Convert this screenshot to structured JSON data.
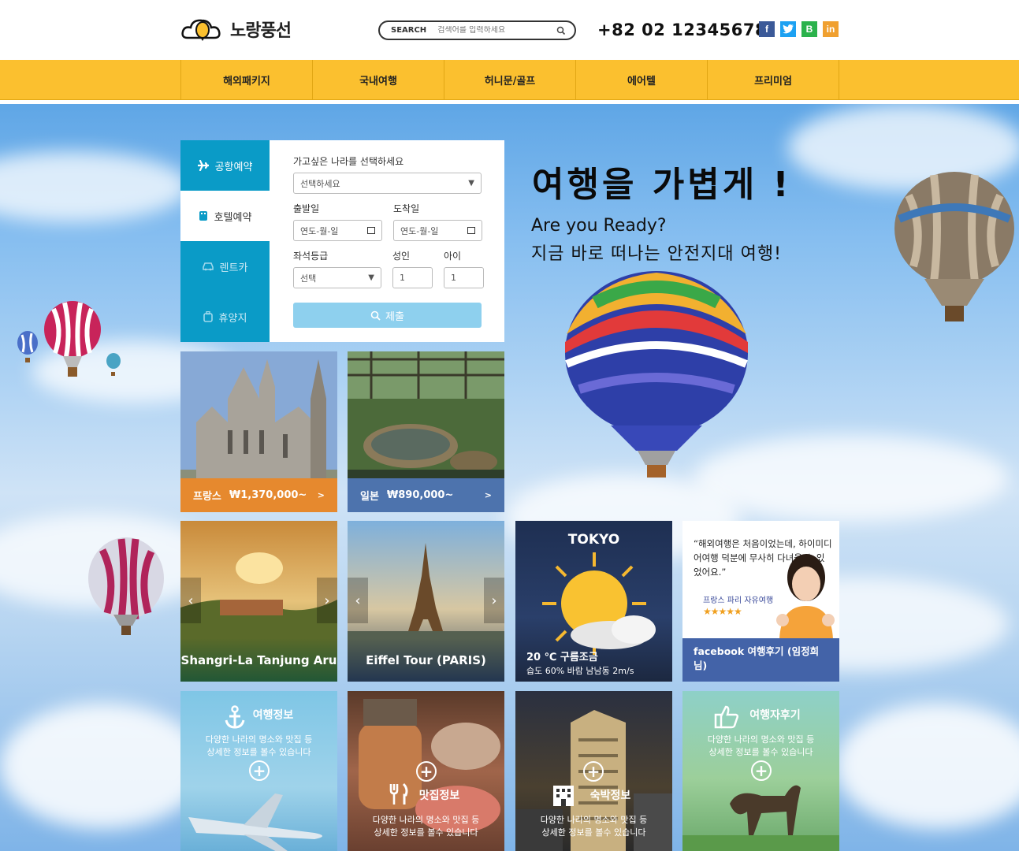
{
  "header": {
    "logo_text": "노랑풍선",
    "search_label": "SEARCH",
    "search_placeholder": "검색어를 입력하세요",
    "phone": "+82 02 12345678",
    "social": [
      {
        "name": "facebook-icon",
        "glyph": "f",
        "color": "#3b5998"
      },
      {
        "name": "twitter-icon",
        "glyph": "t",
        "color": "#1da1f2"
      },
      {
        "name": "blog-icon",
        "glyph": "B",
        "color": "#2bb24c"
      },
      {
        "name": "linkedin-icon",
        "glyph": "in",
        "color": "#f0a030"
      }
    ]
  },
  "nav": {
    "items": [
      "해외패키지",
      "국내여행",
      "허니문/골프",
      "에어텔",
      "프리미엄"
    ]
  },
  "booking": {
    "tabs": [
      {
        "label": "공항예약",
        "icon": "plane-icon"
      },
      {
        "label": "호텔예약",
        "icon": "hotel-icon"
      },
      {
        "label": "렌트카",
        "icon": "car-icon"
      },
      {
        "label": "휴양지",
        "icon": "luggage-icon"
      }
    ],
    "country_label": "가고싶은 나라를 선택하세요",
    "country_value": "선택하세요",
    "depart_label": "출발일",
    "arrive_label": "도착일",
    "date_placeholder": "연도-월-일",
    "seat_label": "좌석등급",
    "seat_value": "선택",
    "adult_label": "성인",
    "adult_value": "1",
    "child_label": "아이",
    "child_value": "1",
    "submit_label": "제출"
  },
  "hero": {
    "headline": "여행을 가볍게 !",
    "sub1": "Are you Ready?",
    "sub2": "지금 바로 떠나는 안전지대 여행!"
  },
  "deals": [
    {
      "country": "프랑스",
      "price": "₩1,370,000~",
      "arrow": ">",
      "color": "#e6892e"
    },
    {
      "country": "일본",
      "price": "₩890,000~",
      "arrow": ">",
      "color": "#4d73ad"
    }
  ],
  "sliders": [
    {
      "caption": "Shangri-La Tanjung Aru",
      "prev": "‹",
      "next": "›"
    },
    {
      "caption": "Eiffel Tour (PARIS)",
      "prev": "‹",
      "next": "›"
    }
  ],
  "weather": {
    "city": "TOKYO",
    "line1": "20 ℃ 구름조금",
    "line2": "습도 60% 바람 남남동 2m/s"
  },
  "review": {
    "quote": "“해외여행은 처음이었는데, 하이미디어여행 덕분에 무사히 다녀올 수 있었어요.”",
    "product": "프랑스 파리 자유여행",
    "stars": "★★★★★",
    "footer": "facebook 여행후기 (임정희님)"
  },
  "info_tiles": [
    {
      "title": "여행정보",
      "desc1": "다양한 나라의 명소와 맛집 등",
      "desc2": "상세한 정보를 볼수 있습니다"
    },
    {
      "title": "맛집정보",
      "desc1": "다양한 나라의 명소와 맛집 등",
      "desc2": "상세한 정보를 볼수 있습니다"
    },
    {
      "title": "숙박정보",
      "desc1": "다양한 나라의 명소와 맛집 등",
      "desc2": "상세한 정보를 볼수 있습니다"
    },
    {
      "title": "여행자후기",
      "desc1": "다양한 나라의 명소와 맛집 등",
      "desc2": "상세한 정보를 볼수 있습니다"
    }
  ]
}
